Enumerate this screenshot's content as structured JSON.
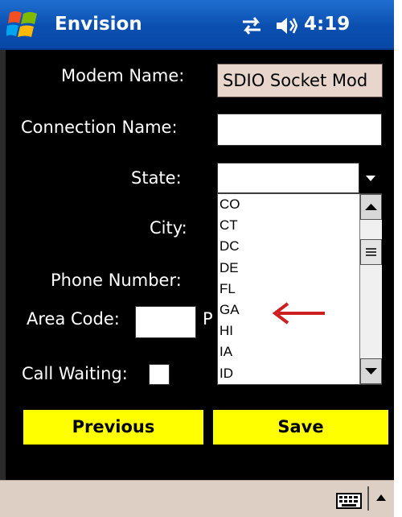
{
  "titlebar": {
    "app_title": "Envision",
    "time": "4:19",
    "icons": [
      "windows-logo",
      "sync-icon",
      "volume-icon"
    ]
  },
  "form": {
    "modem_label": "Modem Name:",
    "modem_value": "SDIO Socket Mod",
    "connection_label": "Connection Name:",
    "connection_value": "",
    "state_label": "State:",
    "state_value": "",
    "city_label": "City:",
    "phone_label": "Phone Number:",
    "area_code_label": "Area Code:",
    "area_code_value": "",
    "phone_partial_label": "P",
    "call_waiting_label": "Call Waiting:"
  },
  "state_list": {
    "items": [
      "CO",
      "CT",
      "DC",
      "DE",
      "FL",
      "GA",
      "HI",
      "IA",
      "ID"
    ]
  },
  "buttons": {
    "previous": "Previous",
    "save": "Save"
  },
  "colors": {
    "titlebar": "#0a4fb0",
    "background": "#000000",
    "button": "#ffff00",
    "annotation_arrow": "#cc1f1f",
    "bottombar": "#ddcfc4"
  }
}
